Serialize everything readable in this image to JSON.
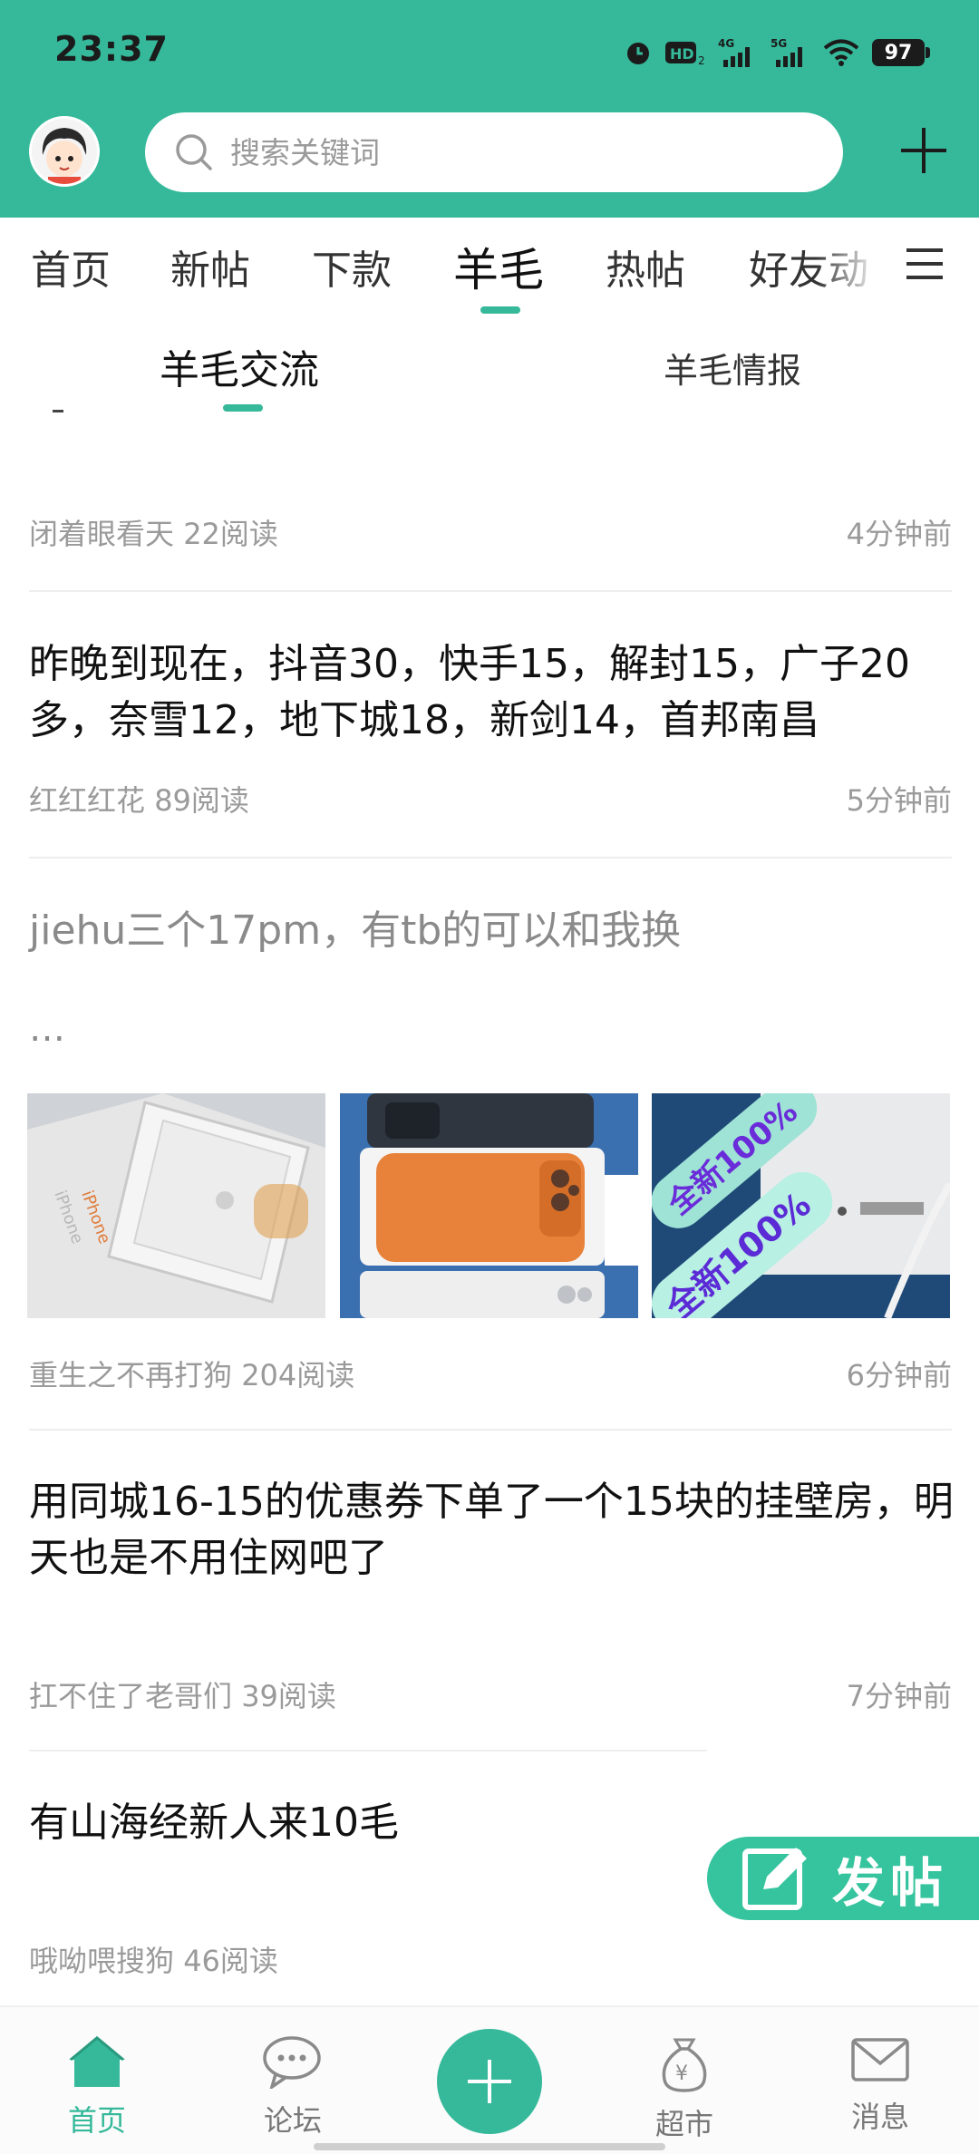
{
  "status_bar": {
    "time": "23:37",
    "battery": "97"
  },
  "search": {
    "placeholder": "搜索关键词"
  },
  "category_tabs": [
    "首页",
    "新帖",
    "下款",
    "羊毛",
    "热帖",
    "好友动"
  ],
  "active_category": "羊毛",
  "sub_tabs": [
    "羊毛交流",
    "羊毛情报"
  ],
  "active_sub_tab": "羊毛交流",
  "posts": [
    {
      "title": "",
      "author": "闭着眼看天",
      "reads": "22阅读",
      "time": "4分钟前"
    },
    {
      "title": "昨晚到现在，抖音30，快手15，解封15，广子20多，奈雪12，地下城18，新剑14，首邦南昌",
      "author": "红红红花",
      "reads": "89阅读",
      "time": "5分钟前"
    },
    {
      "title": "jiehu三个17pm，有tb的可以和我换",
      "excerpt": "…",
      "author": "重生之不再打狗",
      "reads": "204阅读",
      "time": "6分钟前",
      "thumb_stickers": [
        "全新100%",
        "全新100%"
      ]
    },
    {
      "title": "用同城16-15的优惠券下单了一个15块的挂壁房，明天也是不用住网吧了",
      "author": "扛不住了老哥们",
      "reads": "39阅读",
      "time": "7分钟前"
    },
    {
      "title": "有山海经新人来10毛",
      "author": "哦呦喂搜狗",
      "reads": "46阅读",
      "time": ""
    }
  ],
  "fab": {
    "label": "发帖"
  },
  "bottom_nav": [
    {
      "label": "首页",
      "icon": "home-icon"
    },
    {
      "label": "论坛",
      "icon": "chat-bubble-icon"
    },
    {
      "label": "",
      "icon": "plus-icon"
    },
    {
      "label": "超市",
      "icon": "money-bag-icon"
    },
    {
      "label": "消息",
      "icon": "envelope-icon"
    }
  ],
  "colors": {
    "accent": "#35b99a",
    "header_bg": "#35b99a",
    "fab_bg": "#35c49e"
  }
}
